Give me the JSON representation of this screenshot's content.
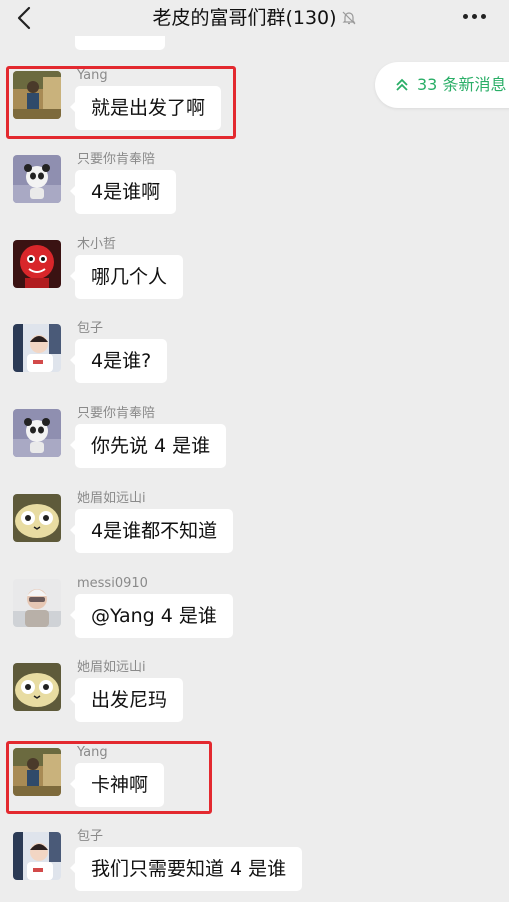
{
  "header": {
    "title": "老皮的富哥们群(130)"
  },
  "new_messages": {
    "label": "33 条新消息"
  },
  "messages": [
    {
      "sender": "Yang",
      "text": "就是出发了啊",
      "avatar": "yang-avatar"
    },
    {
      "sender": "只要你肯奉陪",
      "text": "4是谁啊",
      "avatar": "panda-avatar"
    },
    {
      "sender": "木小哲",
      "text": "哪几个人",
      "avatar": "red-costume-avatar"
    },
    {
      "sender": "包子",
      "text": "4是谁?",
      "avatar": "baozi-avatar"
    },
    {
      "sender": "只要你肯奉陪",
      "text": "你先说 4 是谁",
      "avatar": "panda-avatar"
    },
    {
      "sender": "她眉如远山i",
      "text": "4是谁都不知道",
      "avatar": "cat-avatar"
    },
    {
      "sender": "messi0910",
      "text": "@Yang 4 是谁",
      "avatar": "messi-avatar"
    },
    {
      "sender": "她眉如远山i",
      "text": "出发尼玛",
      "avatar": "cat-avatar"
    },
    {
      "sender": "Yang",
      "text": "卡神啊",
      "avatar": "yang-avatar"
    },
    {
      "sender": "包子",
      "text": "我们只需要知道 4 是谁",
      "avatar": "baozi-avatar"
    }
  ],
  "colors": {
    "background": "#ededed",
    "bubble": "#ffffff",
    "highlight_box": "#e3292f",
    "new_message_text": "#2aae67"
  }
}
